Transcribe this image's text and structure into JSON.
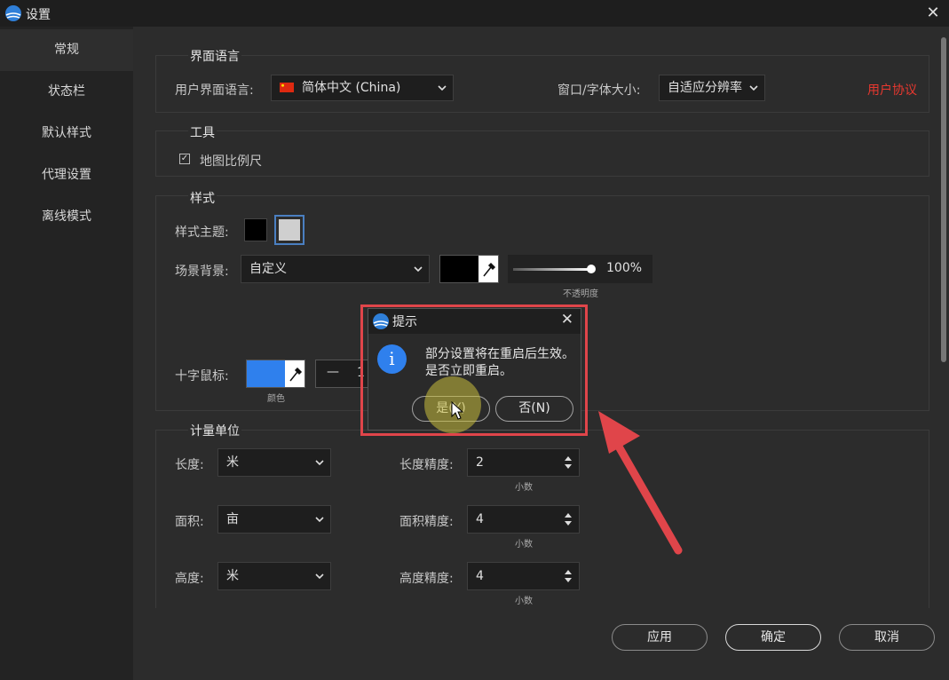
{
  "window": {
    "title": "设置",
    "close_glyph": "✕"
  },
  "sidebar": {
    "items": [
      {
        "label": "常规",
        "active": true
      },
      {
        "label": "状态栏"
      },
      {
        "label": "默认样式"
      },
      {
        "label": "代理设置"
      },
      {
        "label": "离线模式"
      }
    ]
  },
  "language_section": {
    "title": "界面语言",
    "ui_language_label": "用户界面语言:",
    "ui_language_value": "简体中文 (China)",
    "window_font_label": "窗口/字体大小:",
    "window_font_value": "自适应分辨率",
    "user_agreement_link": "用户协议"
  },
  "tools_section": {
    "title": "工具",
    "map_scale_checkbox_label": "地图比例尺",
    "map_scale_checked": true,
    "check_glyph": "✓"
  },
  "style_section": {
    "title": "样式",
    "theme_label": "样式主题:",
    "scene_bg_label": "场景背景:",
    "scene_bg_value": "自定义",
    "opacity_value": "100%",
    "opacity_level": 1.0,
    "opacity_label": "不透明度",
    "crosshair_label": "十字鼠标:",
    "color_label": "颜色",
    "minus_glyph": "—",
    "partial_digit": "1"
  },
  "units_section": {
    "title": "计量单位",
    "length_label": "长度:",
    "length_value": "米",
    "length_precision_label": "长度精度:",
    "length_precision_value": "2",
    "area_label": "面积:",
    "area_value": "亩",
    "area_precision_label": "面积精度:",
    "area_precision_value": "4",
    "height_label": "高度:",
    "height_value": "米",
    "height_precision_label": "高度精度:",
    "height_precision_value": "4",
    "decimal_label": "小数"
  },
  "footer": {
    "apply": "应用",
    "ok": "确定",
    "cancel": "取消"
  },
  "dialog": {
    "title": "提示",
    "message_line1": "部分设置将在重启后生效。",
    "message_line2": "是否立即重启。",
    "yes_button": "是(Y)",
    "no_button": "否(N)",
    "close_glyph": "✕",
    "info_glyph": "i"
  },
  "colors": {
    "accent": "#2f80ed",
    "link": "#e8382f",
    "annotation": "#e0454a"
  }
}
